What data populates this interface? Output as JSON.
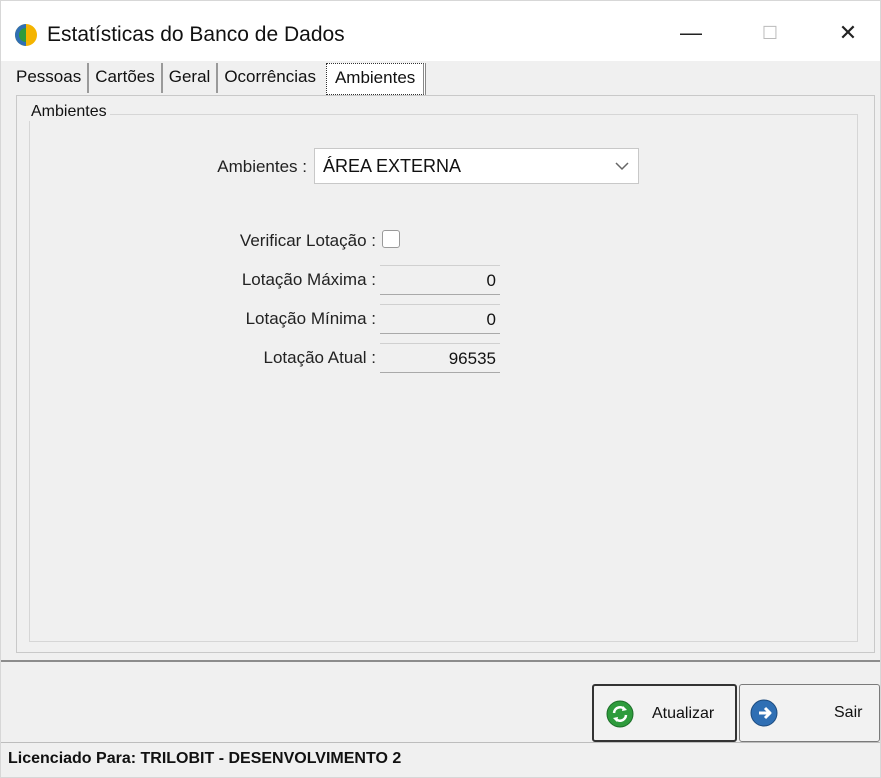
{
  "window": {
    "title": "Estatísticas do Banco de Dados",
    "minimize_glyph": "—",
    "maximize_glyph": "☐",
    "close_glyph": "✕"
  },
  "tabs": [
    {
      "label": "Pessoas"
    },
    {
      "label": "Cartões"
    },
    {
      "label": "Geral"
    },
    {
      "label": "Ocorrências"
    },
    {
      "label": "Ambientes",
      "active": true
    }
  ],
  "group": {
    "title": "Ambientes"
  },
  "form": {
    "ambientes_label": "Ambientes :",
    "ambientes_value": "ÁREA EXTERNA",
    "verificar_label": "Verificar Lotação :",
    "verificar_checked": false,
    "lotacao_maxima_label": "Lotação Máxima :",
    "lotacao_maxima_value": "0",
    "lotacao_minima_label": "Lotação Mínima :",
    "lotacao_minima_value": "0",
    "lotacao_atual_label": "Lotação Atual :",
    "lotacao_atual_value": "96535"
  },
  "buttons": {
    "update_label": "Atualizar",
    "exit_label": "Sair"
  },
  "status_bar": {
    "text": "Licenciado Para: TRILOBIT - DESENVOLVIMENTO 2"
  },
  "icons": {
    "app": "app-logo-icon",
    "combo": "chevron-down-icon",
    "update": "refresh-icon",
    "exit": "exit-icon"
  },
  "colors": {
    "window_bg": "#f0f0f0",
    "titlebar_bg": "#ffffff",
    "icon_green": "#2e9b3c",
    "icon_blue": "#2f6fb4",
    "app_yellow": "#f4b400"
  }
}
